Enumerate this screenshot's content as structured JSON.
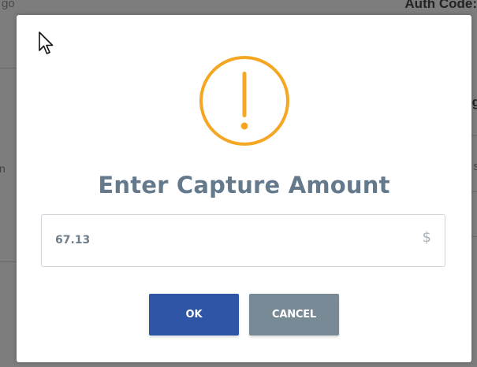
{
  "background": {
    "top_left_fragment": "go",
    "top_right_fragment": "Auth Code:",
    "right_fragment_a": "g",
    "right_fragment_b": "s",
    "left_fragment_a": "n"
  },
  "dialog": {
    "icon": "warning-icon",
    "title": "Enter Capture Amount",
    "amount_value": "67.13",
    "currency_symbol": "$",
    "ok_label": "OK",
    "cancel_label": "CANCEL"
  },
  "colors": {
    "warning": "#f5a623",
    "title": "#647a8c",
    "ok_button": "#2f56a6",
    "cancel_button": "#788a96"
  }
}
